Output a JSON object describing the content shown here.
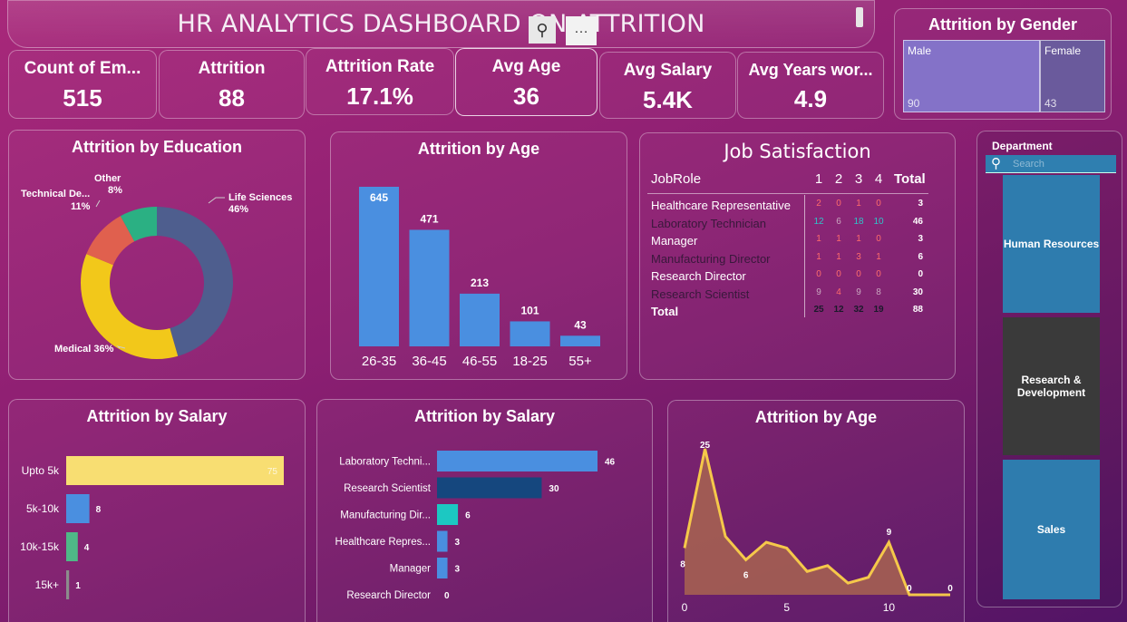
{
  "header": {
    "title": "HR ANALYTICS DASHBOARD ON ATTRITION"
  },
  "kpis": [
    {
      "label": "Count of Em...",
      "value": "515"
    },
    {
      "label": "Attrition",
      "value": "88"
    },
    {
      "label": "Attrition Rate",
      "value": "17.1%"
    },
    {
      "label": "Avg Age",
      "value": "36"
    },
    {
      "label": "Avg Salary",
      "value": "5.4K"
    },
    {
      "label": "Avg Years wor...",
      "value": "4.9"
    }
  ],
  "gender": {
    "title": "Attrition by Gender",
    "male_label": "Male",
    "male_value": "90",
    "female_label": "Female",
    "female_value": "43",
    "colors": {
      "male": "#8472c8",
      "female": "#6a5a9c"
    }
  },
  "education": {
    "title": "Attrition by Education",
    "labels": {
      "life": "Life Sciences",
      "life_pct": "46%",
      "medical": "Medical 36%",
      "tech": "Technical De...",
      "tech_pct": "11%",
      "other": "Other",
      "other_pct": "8%"
    }
  },
  "age_bar": {
    "title": "Attrition by Age"
  },
  "job_sat": {
    "title": "Job Satisfaction",
    "header": [
      "JobRole",
      "1",
      "2",
      "3",
      "4",
      "Total"
    ],
    "rows": [
      {
        "role": "Healthcare Representative",
        "v": [
          "2",
          "0",
          "1",
          "0"
        ],
        "total": "3"
      },
      {
        "role": "Laboratory Technician",
        "v": [
          "12",
          "6",
          "18",
          "10"
        ],
        "total": "46"
      },
      {
        "role": "Manager",
        "v": [
          "1",
          "1",
          "1",
          "0"
        ],
        "total": "3"
      },
      {
        "role": "Manufacturing Director",
        "v": [
          "1",
          "1",
          "3",
          "1"
        ],
        "total": "6"
      },
      {
        "role": "Research Director",
        "v": [
          "0",
          "0",
          "0",
          "0"
        ],
        "total": "0"
      },
      {
        "role": "Research Scientist",
        "v": [
          "9",
          "4",
          "9",
          "8"
        ],
        "total": "30"
      }
    ],
    "total": {
      "role": "Total",
      "v": [
        "25",
        "12",
        "32",
        "19"
      ],
      "total": "88"
    }
  },
  "slicer": {
    "title": "Department",
    "search_placeholder": "Search",
    "items": [
      "Human Resources",
      "Research & Development",
      "Sales"
    ]
  },
  "salary_bar": {
    "title": "Attrition by Salary"
  },
  "role_bar": {
    "title": "Attrition by Salary"
  },
  "age_line": {
    "title": "Attrition by Age"
  },
  "chart_data": [
    {
      "type": "pie",
      "title": "Attrition by Education",
      "categories": [
        "Life Sciences",
        "Medical",
        "Technical De...",
        "Other"
      ],
      "values": [
        46,
        36,
        11,
        8
      ],
      "colors": [
        "#4e5e8e",
        "#f2c81a",
        "#e0604e",
        "#2bb083"
      ]
    },
    {
      "type": "bar",
      "title": "Attrition by Age",
      "categories": [
        "26-35",
        "36-45",
        "46-55",
        "18-25",
        "55+"
      ],
      "values": [
        645,
        471,
        213,
        101,
        43
      ],
      "ylim": [
        0,
        700
      ],
      "color": "#4a8fe0"
    },
    {
      "type": "bar",
      "orientation": "horizontal",
      "title": "Attrition by Salary",
      "categories": [
        "Upto 5k",
        "5k-10k",
        "10k-15k",
        "15k+"
      ],
      "values": [
        75,
        8,
        4,
        1
      ],
      "colors": [
        "#f8de72",
        "#4a8fe0",
        "#4fb887",
        "#8c8c8c"
      ]
    },
    {
      "type": "bar",
      "orientation": "horizontal",
      "title": "Attrition by Salary",
      "categories": [
        "Laboratory Techni...",
        "Research Scientist",
        "Manufacturing Dir...",
        "Healthcare Repres...",
        "Manager",
        "Research Director"
      ],
      "values": [
        46,
        30,
        6,
        3,
        3,
        0
      ],
      "colors": [
        "#4a8fe0",
        "#15477e",
        "#1cc8c2",
        "#4a8fe0",
        "#4a8fe0",
        "#4a8fe0"
      ]
    },
    {
      "type": "area",
      "title": "Attrition by Age",
      "x": [
        0,
        1,
        2,
        3,
        4,
        5,
        6,
        7,
        8,
        9,
        10,
        11,
        12,
        13
      ],
      "values": [
        8,
        25,
        10,
        6,
        9,
        8,
        4,
        5,
        2,
        3,
        9,
        0,
        0,
        0
      ],
      "xticks": [
        "0",
        "5",
        "10"
      ],
      "data_labels": [
        "8",
        "25",
        "6",
        "9",
        "0",
        "0"
      ],
      "color": "#f5c84a"
    }
  ]
}
